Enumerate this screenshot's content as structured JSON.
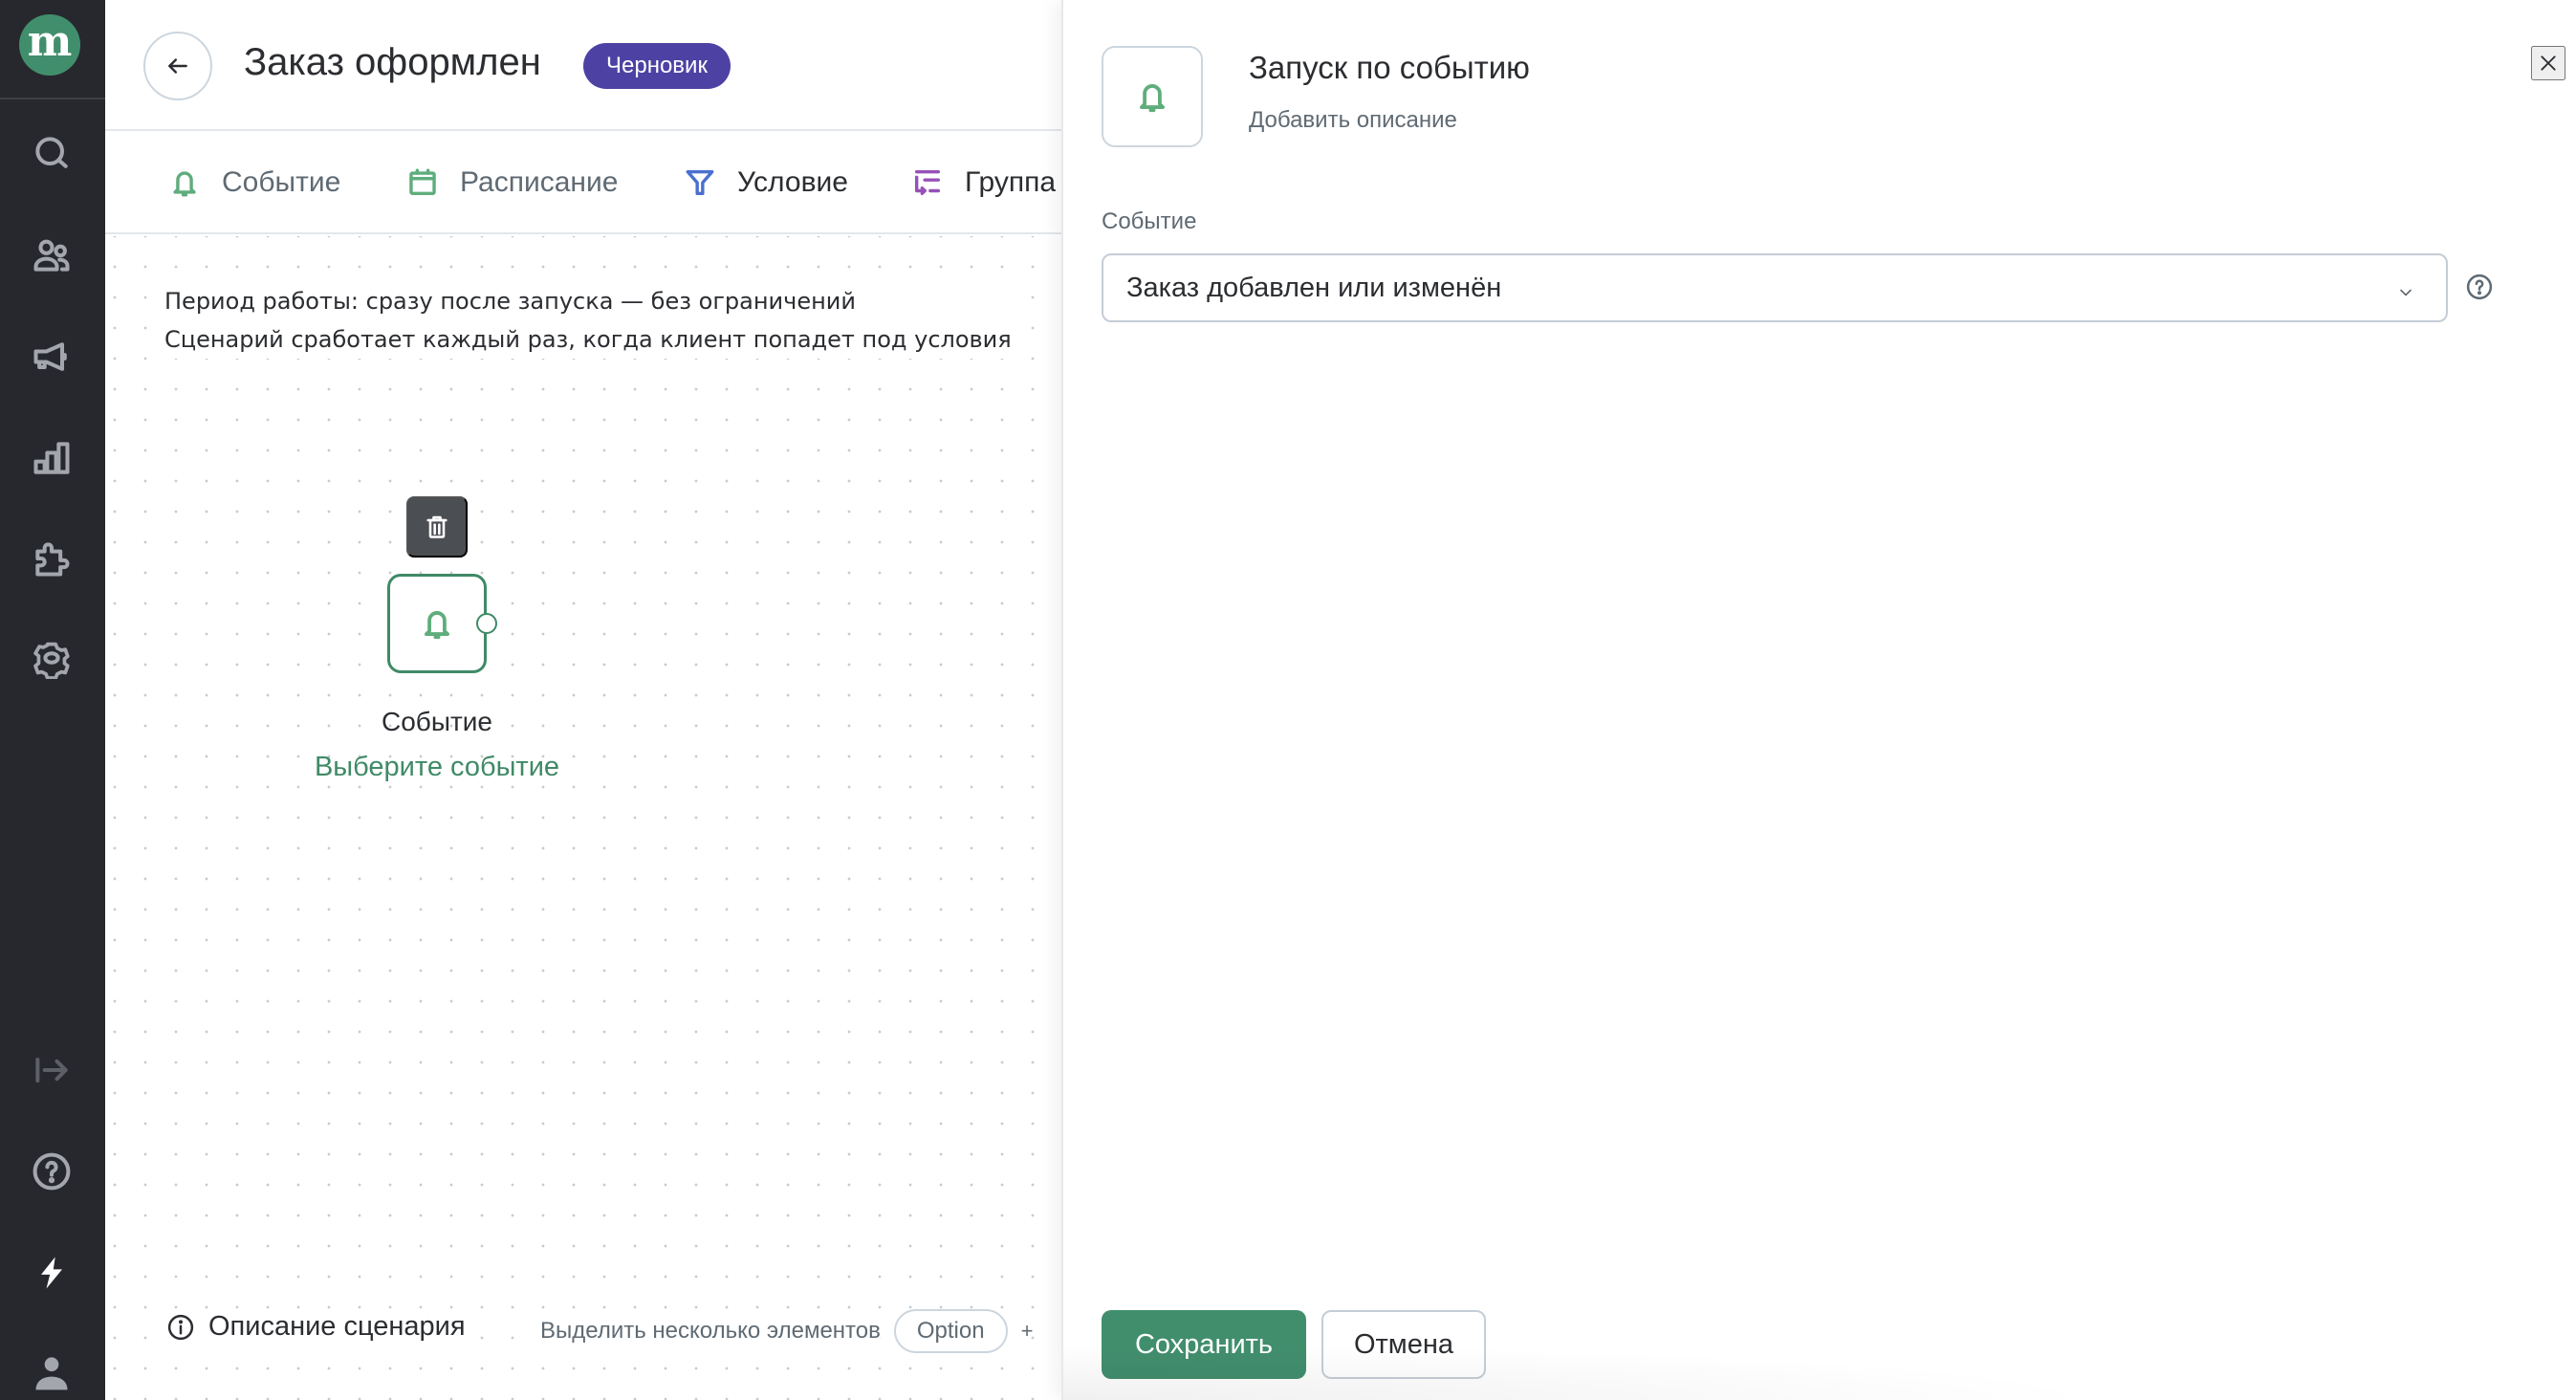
{
  "sidebar": {
    "logo_letter": "m",
    "items": [
      {
        "name": "search",
        "icon": "search-icon"
      },
      {
        "name": "audience",
        "icon": "users-icon"
      },
      {
        "name": "campaigns",
        "icon": "megaphone-icon"
      },
      {
        "name": "analytics",
        "icon": "bar-chart-icon"
      },
      {
        "name": "integrations",
        "icon": "puzzle-icon"
      },
      {
        "name": "settings",
        "icon": "gear-icon"
      }
    ],
    "bottom_items": [
      {
        "name": "expand",
        "icon": "expand-arrow-icon"
      },
      {
        "name": "help",
        "icon": "help-icon"
      },
      {
        "name": "quick-actions",
        "icon": "lightning-icon"
      },
      {
        "name": "profile",
        "icon": "user-icon"
      }
    ]
  },
  "header": {
    "title": "Заказ оформлен",
    "status_badge": "Черновик",
    "badge_color": "#4d41a3"
  },
  "tabs": [
    {
      "label": "Событие",
      "icon": "bell-icon",
      "icon_color": "#5fad7c"
    },
    {
      "label": "Расписание",
      "icon": "calendar-icon",
      "icon_color": "#5fad7c"
    },
    {
      "label": "Условие",
      "icon": "filter-icon",
      "icon_color": "#4a6fd0"
    },
    {
      "label": "Группа",
      "icon": "group-icon",
      "icon_color": "#9651b8"
    }
  ],
  "canvas": {
    "info_line1": "Период работы: сразу после запуска — без ограничений",
    "info_line2": "Сценарий сработает каждый раз, когда клиент попадет под условия",
    "node": {
      "title": "Событие",
      "subtitle": "Выберите событие"
    },
    "footer": {
      "description_link": "Описание сценария",
      "hint": "Выделить несколько элементов",
      "key": "Option",
      "plus": "+"
    }
  },
  "panel": {
    "title": "Запуск по событию",
    "description_placeholder": "Добавить описание",
    "field_label": "Событие",
    "select_value": "Заказ добавлен или изменён",
    "save_label": "Сохранить",
    "cancel_label": "Отмена",
    "accent_color": "#418e6d"
  }
}
